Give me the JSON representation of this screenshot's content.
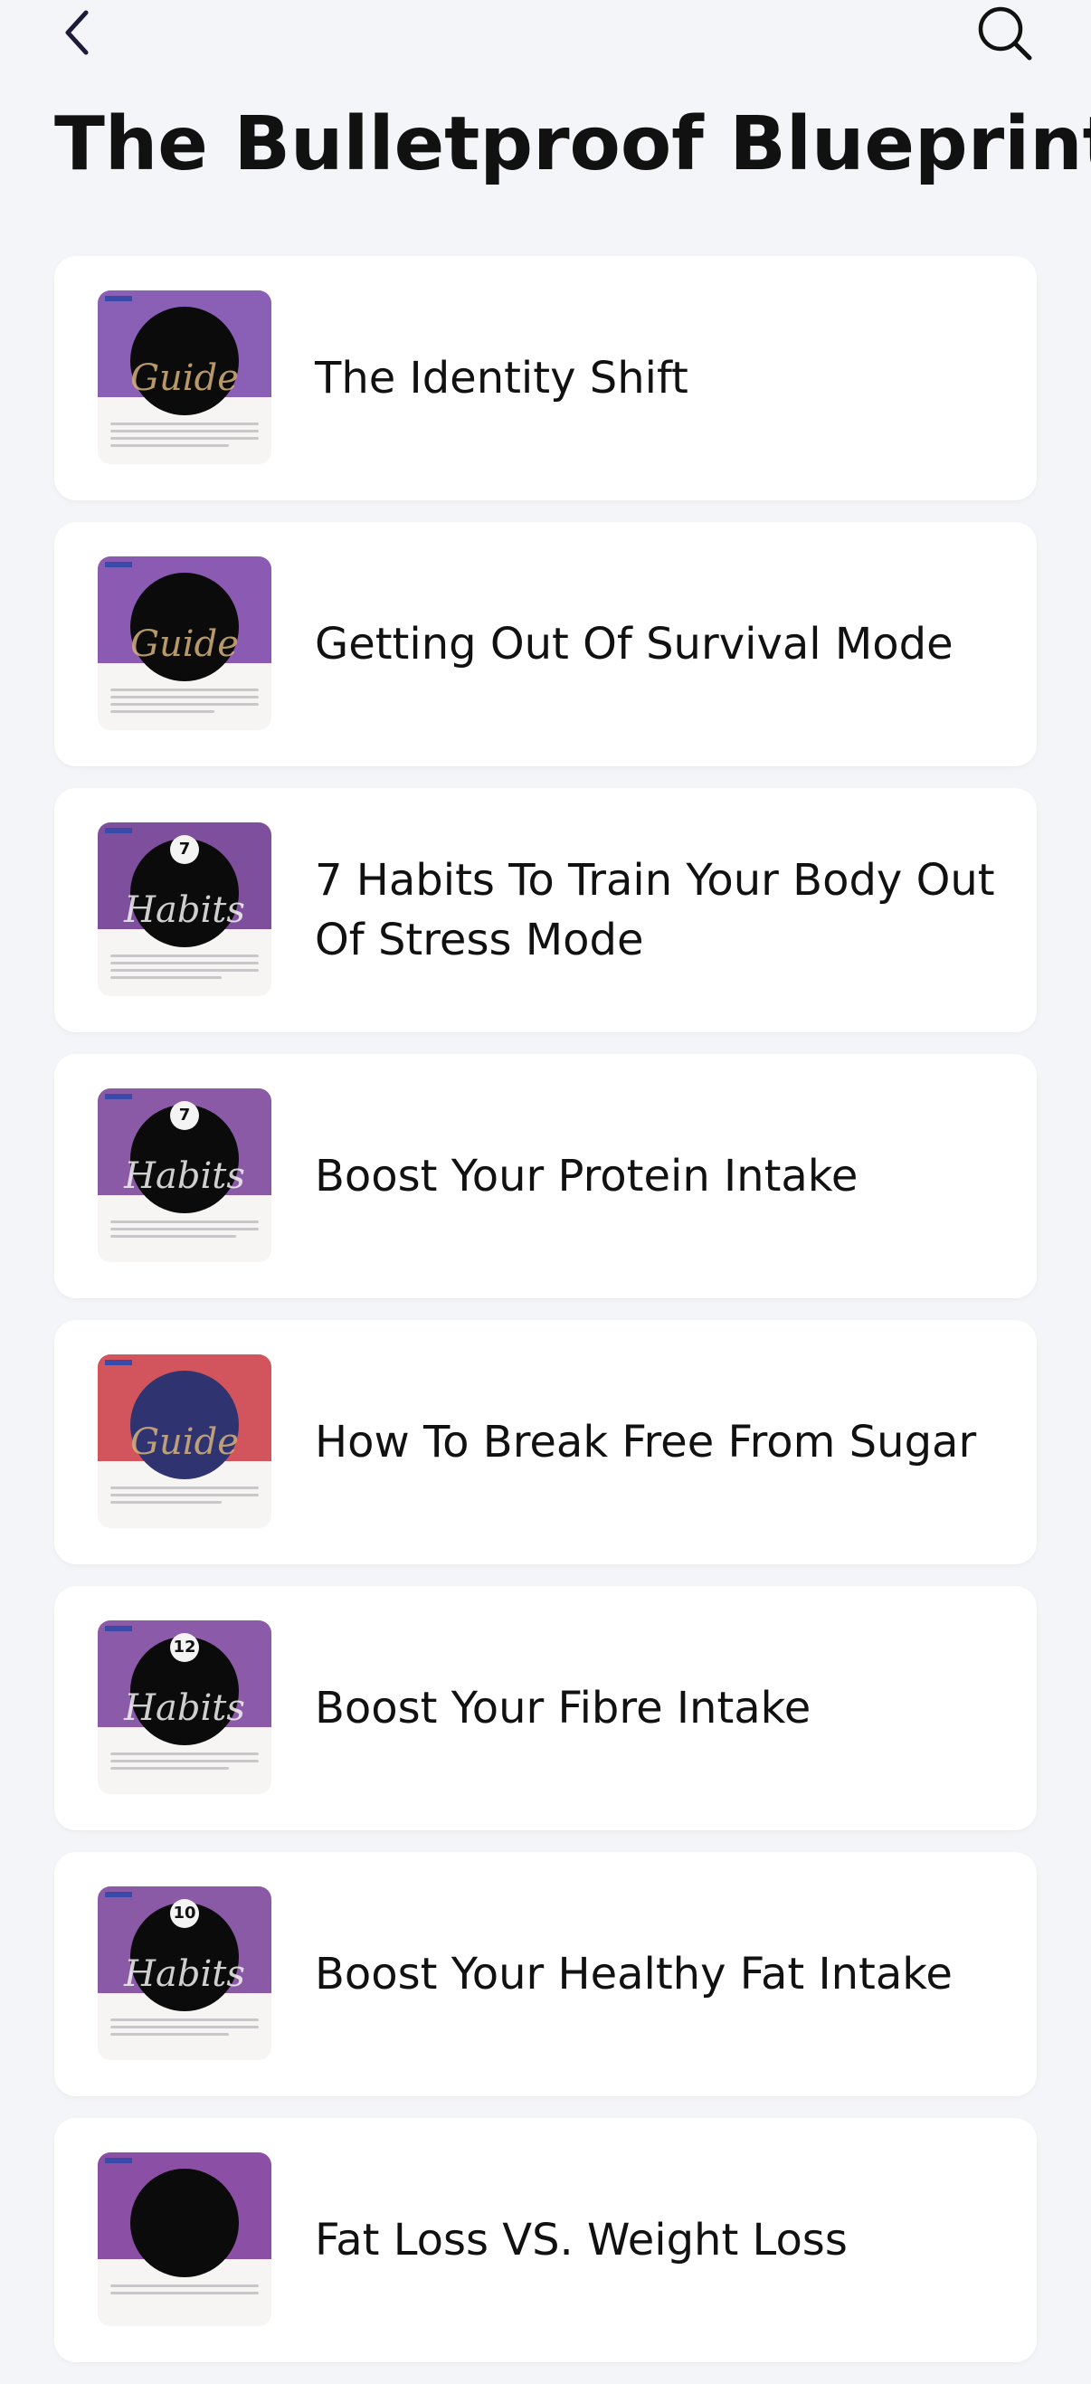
{
  "header": {
    "back_icon": "chevron-left-icon",
    "search_icon": "search-icon",
    "title": "The Bulletproof Blueprint"
  },
  "colors": {
    "background": "#f4f5f8",
    "card": "#ffffff",
    "title_text": "#111111",
    "accent_purple": "#7b4fa8",
    "accent_red": "#d2545c"
  },
  "items": [
    {
      "title": "The Identity Shift",
      "thumb_script": "Guide",
      "thumb_badge": ""
    },
    {
      "title": "Getting Out Of Survival Mode",
      "thumb_script": "Guide",
      "thumb_badge": ""
    },
    {
      "title": "7 Habits To Train Your Body Out Of Stress Mode",
      "thumb_script": "Habits",
      "thumb_badge": "7"
    },
    {
      "title": "Boost Your Protein Intake",
      "thumb_script": "Habits",
      "thumb_badge": "7"
    },
    {
      "title": "How To Break Free From Sugar",
      "thumb_script": "Guide",
      "thumb_badge": ""
    },
    {
      "title": "Boost Your Fibre Intake",
      "thumb_script": "Habits",
      "thumb_badge": "12"
    },
    {
      "title": "Boost Your Healthy Fat Intake",
      "thumb_script": "Habits",
      "thumb_badge": "10"
    },
    {
      "title": "Fat Loss VS. Weight Loss",
      "thumb_script": "",
      "thumb_badge": ""
    }
  ]
}
